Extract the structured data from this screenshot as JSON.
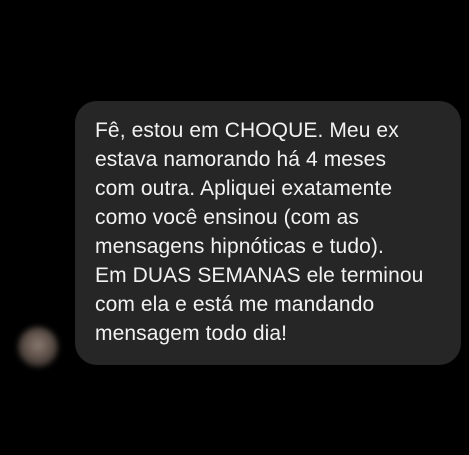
{
  "colors": {
    "background": "#000000",
    "bubble": "#262626",
    "text": "#f2f2f2"
  },
  "message": {
    "sender_avatar_icon": "blurred-avatar",
    "lines": [
      "Fê, estou em CHOQUE. Meu ex",
      "estava namorando há 4 meses",
      "com outra. Apliquei exatamente",
      "como você ensinou (com as",
      "mensagens hipnóticas e tudo).",
      "Em DUAS SEMANAS ele terminou",
      "com ela e está me mandando",
      "mensagem todo dia!"
    ]
  }
}
